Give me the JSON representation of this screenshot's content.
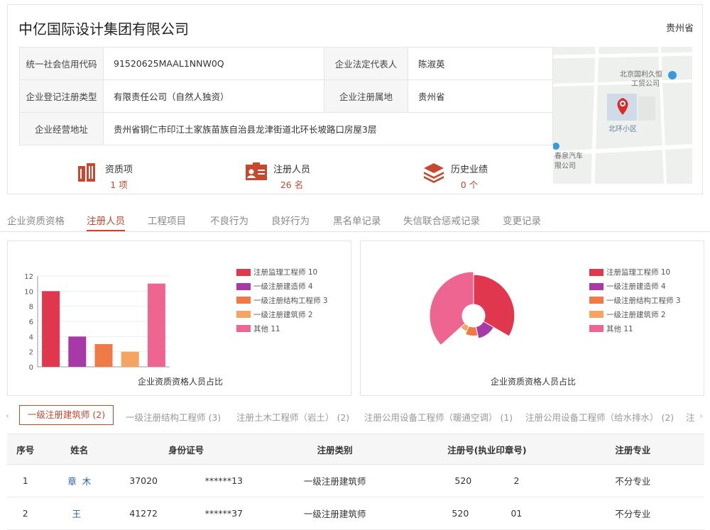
{
  "company": {
    "name": "中亿国际设计集团有限公司",
    "province": "贵州省"
  },
  "info": {
    "credit_code_label": "统一社会信用代码",
    "credit_code": "91520625MAAL1NNW0Q",
    "legal_rep_label": "企业法定代表人",
    "legal_rep": "陈淑英",
    "reg_type_label": "企业登记注册类型",
    "reg_type": "有限责任公司（自然人独资）",
    "reg_place_label": "企业注册属地",
    "reg_place": "贵州省",
    "address_label": "企业经营地址",
    "address": "贵州省铜仁市印江土家族苗族自治县龙津街道北环长坡路口房屋3层"
  },
  "map": {
    "label_top": "北京国利久恒",
    "label_top2": "工贸公司",
    "label_mid": "北环小区",
    "label_bottom": "春泉汽车",
    "label_bottom2": "限公司"
  },
  "stats": [
    {
      "label": "资质项",
      "value": "1 项",
      "icon": "building-icon"
    },
    {
      "label": "注册人员",
      "value": "26 名",
      "icon": "id-card-icon"
    },
    {
      "label": "历史业绩",
      "value": "0 个",
      "icon": "layers-icon"
    }
  ],
  "tabs": [
    "企业资质资格",
    "注册人员",
    "工程项目",
    "不良行为",
    "良好行为",
    "黑名单记录",
    "失信联合惩戒记录",
    "变更记录"
  ],
  "charts": {
    "legend": [
      {
        "label": "注册监理工程师 10",
        "color": "#e0374f"
      },
      {
        "label": "一级注册建造师 4",
        "color": "#a83aa8"
      },
      {
        "label": "一级注册结构工程师 3",
        "color": "#f07a45"
      },
      {
        "label": "一级注册建筑师 2",
        "color": "#f5a461"
      },
      {
        "label": "其他 11",
        "color": "#ef6592"
      }
    ],
    "caption_left": "企业资质资格人员占比",
    "caption_right": "企业资质资格人员占比"
  },
  "chart_data": [
    {
      "type": "bar",
      "categories": [
        "注册监理工程师",
        "一级注册建造师",
        "一级注册结构工程师",
        "一级注册建筑师",
        "其他"
      ],
      "values": [
        10,
        4,
        3,
        2,
        11
      ],
      "colors": [
        "#e0374f",
        "#a83aa8",
        "#f07a45",
        "#f5a461",
        "#ef6592"
      ],
      "ylim": [
        0,
        12
      ],
      "yticks": [
        0,
        2,
        4,
        6,
        8,
        10,
        12
      ],
      "title": "企业资质资格人员占比"
    },
    {
      "type": "pie",
      "variant": "rose",
      "labels": [
        "注册监理工程师",
        "一级注册建造师",
        "一级注册结构工程师",
        "一级注册建筑师",
        "其他"
      ],
      "values": [
        10,
        4,
        3,
        2,
        11
      ],
      "colors": [
        "#e0374f",
        "#a83aa8",
        "#f07a45",
        "#f5a461",
        "#ef6592"
      ],
      "title": "企业资质资格人员占比"
    }
  ],
  "subtabs": [
    "一级注册建筑师 (2)",
    "一级注册结构工程师 (3)",
    "注册土木工程师（岩土） (2)",
    "注册公用设备工程师（暖通空调） (1)",
    "注册公用设备工程师（给水排水） (2)",
    "注"
  ],
  "people": {
    "headers": [
      "序号",
      "姓名",
      "身份证号",
      "注册类别",
      "注册号(执业印章号)",
      "注册专业"
    ],
    "rows": [
      {
        "no": "1",
        "name_a": "章",
        "name_b": "木",
        "id_a": "37020",
        "id_b": "******13",
        "type": "一级注册建筑师",
        "reg_a": "520",
        "reg_b": "2",
        "major": "不分专业"
      },
      {
        "no": "2",
        "name_a": "王",
        "name_b": "",
        "id_a": "41272",
        "id_b": "******37",
        "type": "一级注册建筑师",
        "reg_a": "520",
        "reg_b": "01",
        "major": "不分专业"
      }
    ]
  }
}
